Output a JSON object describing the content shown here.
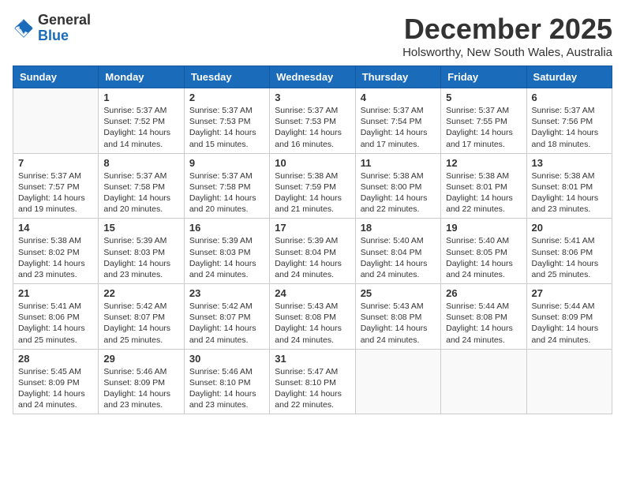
{
  "logo": {
    "general": "General",
    "blue": "Blue"
  },
  "title": "December 2025",
  "subtitle": "Holsworthy, New South Wales, Australia",
  "days_of_week": [
    "Sunday",
    "Monday",
    "Tuesday",
    "Wednesday",
    "Thursday",
    "Friday",
    "Saturday"
  ],
  "weeks": [
    [
      {
        "day": "",
        "content": ""
      },
      {
        "day": "1",
        "content": "Sunrise: 5:37 AM\nSunset: 7:52 PM\nDaylight: 14 hours\nand 14 minutes."
      },
      {
        "day": "2",
        "content": "Sunrise: 5:37 AM\nSunset: 7:53 PM\nDaylight: 14 hours\nand 15 minutes."
      },
      {
        "day": "3",
        "content": "Sunrise: 5:37 AM\nSunset: 7:53 PM\nDaylight: 14 hours\nand 16 minutes."
      },
      {
        "day": "4",
        "content": "Sunrise: 5:37 AM\nSunset: 7:54 PM\nDaylight: 14 hours\nand 17 minutes."
      },
      {
        "day": "5",
        "content": "Sunrise: 5:37 AM\nSunset: 7:55 PM\nDaylight: 14 hours\nand 17 minutes."
      },
      {
        "day": "6",
        "content": "Sunrise: 5:37 AM\nSunset: 7:56 PM\nDaylight: 14 hours\nand 18 minutes."
      }
    ],
    [
      {
        "day": "7",
        "content": "Sunrise: 5:37 AM\nSunset: 7:57 PM\nDaylight: 14 hours\nand 19 minutes."
      },
      {
        "day": "8",
        "content": "Sunrise: 5:37 AM\nSunset: 7:58 PM\nDaylight: 14 hours\nand 20 minutes."
      },
      {
        "day": "9",
        "content": "Sunrise: 5:37 AM\nSunset: 7:58 PM\nDaylight: 14 hours\nand 20 minutes."
      },
      {
        "day": "10",
        "content": "Sunrise: 5:38 AM\nSunset: 7:59 PM\nDaylight: 14 hours\nand 21 minutes."
      },
      {
        "day": "11",
        "content": "Sunrise: 5:38 AM\nSunset: 8:00 PM\nDaylight: 14 hours\nand 22 minutes."
      },
      {
        "day": "12",
        "content": "Sunrise: 5:38 AM\nSunset: 8:01 PM\nDaylight: 14 hours\nand 22 minutes."
      },
      {
        "day": "13",
        "content": "Sunrise: 5:38 AM\nSunset: 8:01 PM\nDaylight: 14 hours\nand 23 minutes."
      }
    ],
    [
      {
        "day": "14",
        "content": "Sunrise: 5:38 AM\nSunset: 8:02 PM\nDaylight: 14 hours\nand 23 minutes."
      },
      {
        "day": "15",
        "content": "Sunrise: 5:39 AM\nSunset: 8:03 PM\nDaylight: 14 hours\nand 23 minutes."
      },
      {
        "day": "16",
        "content": "Sunrise: 5:39 AM\nSunset: 8:03 PM\nDaylight: 14 hours\nand 24 minutes."
      },
      {
        "day": "17",
        "content": "Sunrise: 5:39 AM\nSunset: 8:04 PM\nDaylight: 14 hours\nand 24 minutes."
      },
      {
        "day": "18",
        "content": "Sunrise: 5:40 AM\nSunset: 8:04 PM\nDaylight: 14 hours\nand 24 minutes."
      },
      {
        "day": "19",
        "content": "Sunrise: 5:40 AM\nSunset: 8:05 PM\nDaylight: 14 hours\nand 24 minutes."
      },
      {
        "day": "20",
        "content": "Sunrise: 5:41 AM\nSunset: 8:06 PM\nDaylight: 14 hours\nand 25 minutes."
      }
    ],
    [
      {
        "day": "21",
        "content": "Sunrise: 5:41 AM\nSunset: 8:06 PM\nDaylight: 14 hours\nand 25 minutes."
      },
      {
        "day": "22",
        "content": "Sunrise: 5:42 AM\nSunset: 8:07 PM\nDaylight: 14 hours\nand 25 minutes."
      },
      {
        "day": "23",
        "content": "Sunrise: 5:42 AM\nSunset: 8:07 PM\nDaylight: 14 hours\nand 24 minutes."
      },
      {
        "day": "24",
        "content": "Sunrise: 5:43 AM\nSunset: 8:08 PM\nDaylight: 14 hours\nand 24 minutes."
      },
      {
        "day": "25",
        "content": "Sunrise: 5:43 AM\nSunset: 8:08 PM\nDaylight: 14 hours\nand 24 minutes."
      },
      {
        "day": "26",
        "content": "Sunrise: 5:44 AM\nSunset: 8:08 PM\nDaylight: 14 hours\nand 24 minutes."
      },
      {
        "day": "27",
        "content": "Sunrise: 5:44 AM\nSunset: 8:09 PM\nDaylight: 14 hours\nand 24 minutes."
      }
    ],
    [
      {
        "day": "28",
        "content": "Sunrise: 5:45 AM\nSunset: 8:09 PM\nDaylight: 14 hours\nand 24 minutes."
      },
      {
        "day": "29",
        "content": "Sunrise: 5:46 AM\nSunset: 8:09 PM\nDaylight: 14 hours\nand 23 minutes."
      },
      {
        "day": "30",
        "content": "Sunrise: 5:46 AM\nSunset: 8:10 PM\nDaylight: 14 hours\nand 23 minutes."
      },
      {
        "day": "31",
        "content": "Sunrise: 5:47 AM\nSunset: 8:10 PM\nDaylight: 14 hours\nand 22 minutes."
      },
      {
        "day": "",
        "content": ""
      },
      {
        "day": "",
        "content": ""
      },
      {
        "day": "",
        "content": ""
      }
    ]
  ]
}
